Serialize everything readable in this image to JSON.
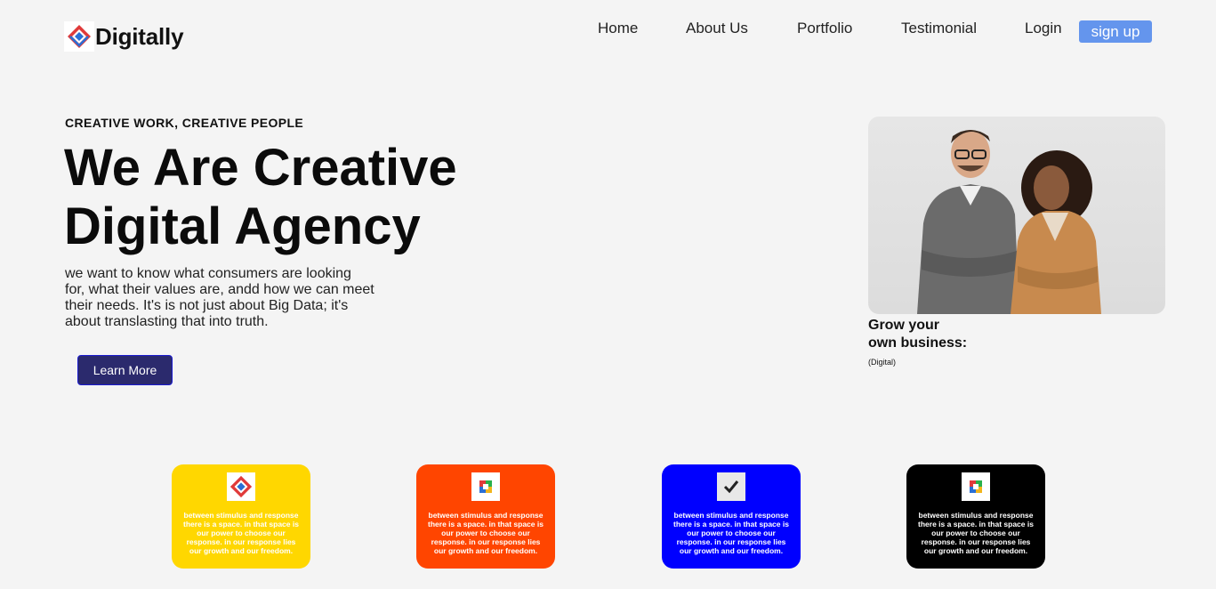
{
  "brand": {
    "name": "Digitally",
    "logo_icon": "diamond-logo-icon",
    "logo_colors": [
      "#e03a3a",
      "#2a6fd6"
    ]
  },
  "nav": {
    "items": [
      {
        "label": "Home"
      },
      {
        "label": "About Us"
      },
      {
        "label": "Portfolio"
      },
      {
        "label": "Testimonial"
      },
      {
        "label": "Login"
      }
    ],
    "signup_label": "sign up",
    "signup_color": "#6495ed"
  },
  "hero": {
    "eyebrow": "CREATIVE WORK, CREATIVE PEOPLE",
    "title_line1": "We Are Creative",
    "title_line2": "Digital Agency",
    "lead_lines": [
      "we want to know what consumers are looking",
      "for, what their values are, andd how we can meet",
      "their needs. It's is not just about Big Data; it's",
      "about translasting that into truth."
    ],
    "cta_label": "Learn More",
    "cta_color": "#2b2a6d"
  },
  "aside": {
    "image_icon": "business-people-photo",
    "title_line1": "Grow your",
    "title_line2": "own business:",
    "subtitle": "(Digital)"
  },
  "cards": [
    {
      "color": "#ffd700",
      "icon": "diamond-logo-icon",
      "text_lines": [
        "between stimulus and response",
        "there is a space. in that space is",
        "our power to choose our",
        "response. in our response lies",
        "our growth and our freedom."
      ]
    },
    {
      "color": "#ff4500",
      "icon": "color-square-icon",
      "text_lines": [
        "between stimulus and response",
        "there is a space. in that space is",
        "our power to choose our",
        "response. in our response lies",
        "our growth and our freedom."
      ]
    },
    {
      "color": "#0000ff",
      "icon": "checkmark-icon",
      "text_lines": [
        "between stimulus and response",
        "there is a space. in that space is",
        "our power to choose our",
        "response. in our response lies",
        "our growth and our freedom."
      ]
    },
    {
      "color": "#000000",
      "icon": "color-square-icon",
      "text_lines": [
        "between stimulus and response",
        "there is a space. in that space is",
        "our power to choose our",
        "response. in our response lies",
        "our growth and our freedom."
      ]
    }
  ]
}
